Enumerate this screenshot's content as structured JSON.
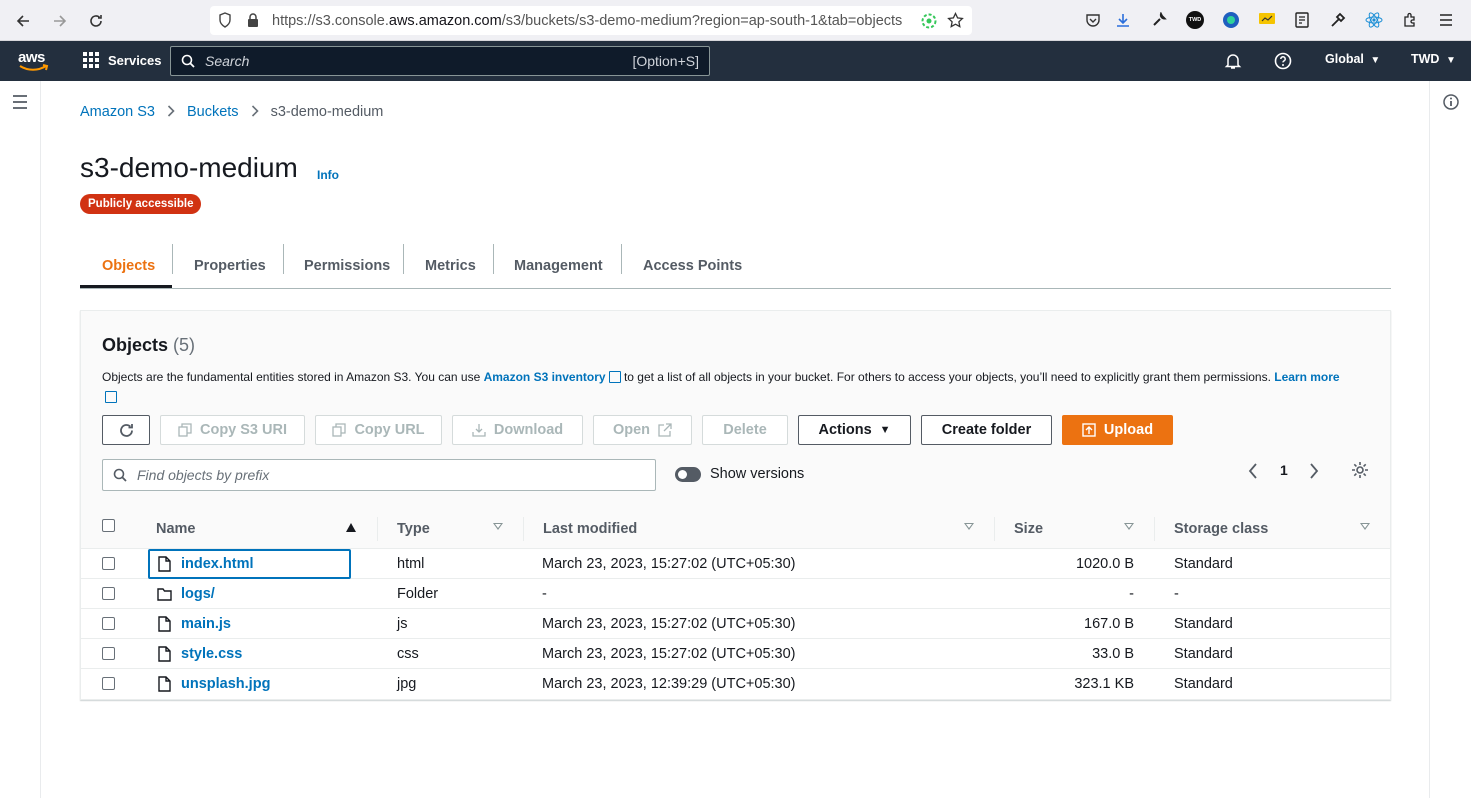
{
  "browser": {
    "url_prefix": "https://s3.console.",
    "url_domain": "aws.amazon.com",
    "url_path": "/s3/buckets/s3-demo-medium?region=ap-south-1&tab=objects",
    "ext_badge": "TWD"
  },
  "aws_bar": {
    "logo_text": "aws",
    "services_label": "Services",
    "search_placeholder": "Search",
    "search_shortcut": "[Option+S]",
    "region_label": "Global",
    "account_label": "TWD"
  },
  "breadcrumb": {
    "items": [
      "Amazon S3",
      "Buckets"
    ],
    "current": "s3-demo-medium"
  },
  "page": {
    "title": "s3-demo-medium",
    "info_label": "Info",
    "badge": "Publicly accessible"
  },
  "tabs": [
    "Objects",
    "Properties",
    "Permissions",
    "Metrics",
    "Management",
    "Access Points"
  ],
  "objects_panel": {
    "title": "Objects",
    "count": "(5)",
    "desc_before": "Objects are the fundamental entities stored in Amazon S3. You can use ",
    "desc_link": "Amazon S3 inventory",
    "desc_after": " to get a list of all objects in your bucket. For others to access your objects, you’ll need to explicitly grant them permissions. ",
    "learn_more": "Learn more",
    "buttons": {
      "copy_s3_uri": "Copy S3 URI",
      "copy_url": "Copy URL",
      "download": "Download",
      "open": "Open",
      "delete": "Delete",
      "actions": "Actions",
      "create_folder": "Create folder",
      "upload": "Upload"
    },
    "filter_placeholder": "Find objects by prefix",
    "show_versions_label": "Show versions",
    "page_number": "1"
  },
  "table": {
    "columns": [
      "Name",
      "Type",
      "Last modified",
      "Size",
      "Storage class"
    ],
    "rows": [
      {
        "name": "index.html",
        "icon": "file-icon",
        "type": "html",
        "modified": "March 23, 2023, 15:27:02 (UTC+05:30)",
        "size": "1020.0 B",
        "storage": "Standard"
      },
      {
        "name": "logs/",
        "icon": "folder-icon",
        "type": "Folder",
        "modified": "-",
        "size": "-",
        "storage": "-"
      },
      {
        "name": "main.js",
        "icon": "file-icon",
        "type": "js",
        "modified": "March 23, 2023, 15:27:02 (UTC+05:30)",
        "size": "167.0 B",
        "storage": "Standard"
      },
      {
        "name": "style.css",
        "icon": "file-icon",
        "type": "css",
        "modified": "March 23, 2023, 15:27:02 (UTC+05:30)",
        "size": "33.0 B",
        "storage": "Standard"
      },
      {
        "name": "unsplash.jpg",
        "icon": "file-icon",
        "type": "jpg",
        "modified": "March 23, 2023, 12:39:29 (UTC+05:30)",
        "size": "323.1 KB",
        "storage": "Standard"
      }
    ]
  },
  "colors": {
    "aws_dark": "#232f3e",
    "accent_orange": "#ec7211",
    "link_blue": "#0073bb",
    "danger_red": "#d13212"
  }
}
